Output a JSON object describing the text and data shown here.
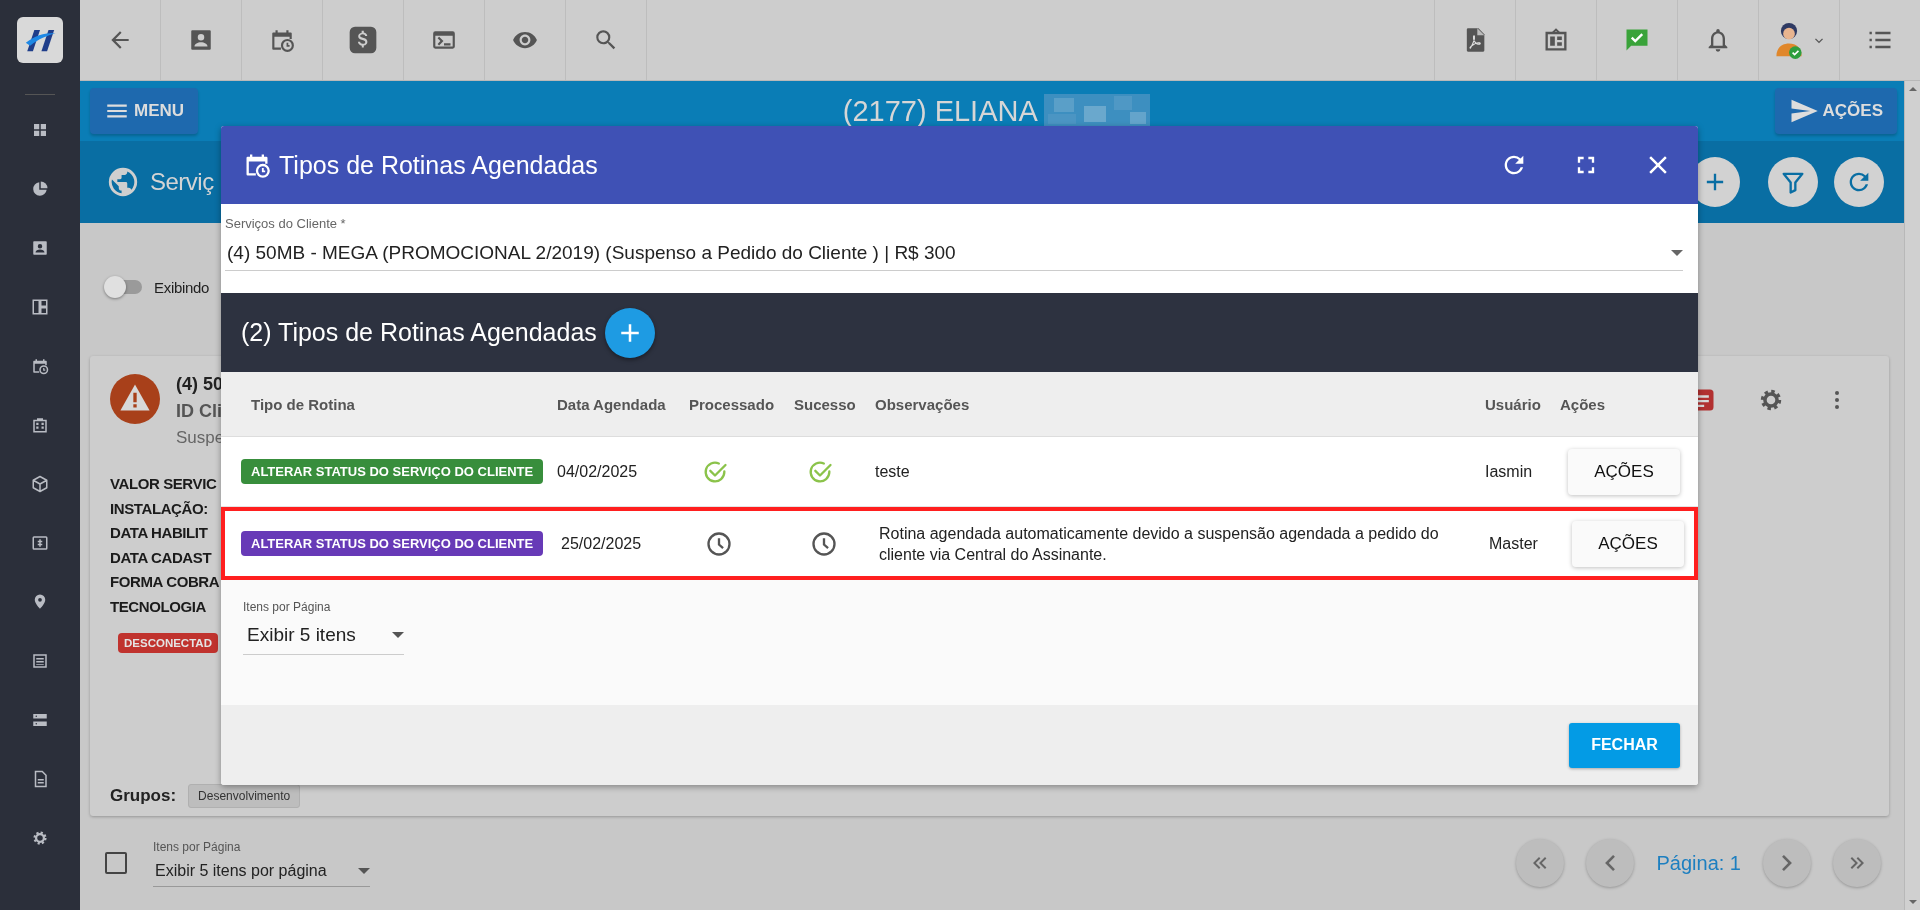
{
  "header": {
    "menu_button": "MENU",
    "title": "(2177) ELIANA",
    "actions_button": "AÇÕES"
  },
  "page": {
    "title": "Serviç",
    "toggle": {
      "label": "Exibindo",
      "on": false
    }
  },
  "service_card": {
    "title": "(4) 50",
    "id_line": "ID Cli",
    "status": "Suspe",
    "fields": [
      "VALOR SERVIC",
      "INSTALAÇÃO:",
      "DATA HABILIT",
      "DATA CADAST",
      "FORMA COBRA",
      "TECNOLOGIA"
    ],
    "connection_badge": "DESCONECTAD",
    "groups_label": "Grupos:",
    "groups": [
      "Desenvolvimento"
    ]
  },
  "pagination": {
    "select_all_checked": false,
    "items_label": "Itens por Página",
    "items_value": "Exibir 5 itens por página",
    "page": "Página: 1"
  },
  "modal": {
    "title": "Tipos de Rotinas Agendadas",
    "service_select": {
      "label": "Serviços do Cliente *",
      "value": "(4) 50MB - MEGA (PROMOCIONAL 2/2019) (Suspenso a Pedido do Cliente ) | R$ 300"
    },
    "section_title": "(2) Tipos de Rotinas Agendadas",
    "table": {
      "columns": [
        "Tipo de Rotina",
        "Data Agendada",
        "Processado",
        "Sucesso",
        "Observações",
        "Usuário",
        "Ações"
      ],
      "rows": [
        {
          "type": "ALTERAR STATUS DO SERVIÇO DO CLIENTE",
          "color": "#388e3c",
          "date": "04/02/2025",
          "processed": true,
          "success": true,
          "notes": "teste",
          "user": "Iasmin",
          "action": "AÇÕES",
          "highlighted": false
        },
        {
          "type": "ALTERAR STATUS DO SERVIÇO DO CLIENTE",
          "color": "#673ab7",
          "date": "25/02/2025",
          "processed": false,
          "success": false,
          "notes": "Rotina agendada automaticamente devido a suspensão agendada a pedido do cliente via Central do Assinante.",
          "user": "Master",
          "action": "AÇÕES",
          "highlighted": true
        }
      ]
    },
    "items_label": "Itens por Página",
    "items_value": "Exibir 5 itens",
    "close_button": "FECHAR"
  }
}
